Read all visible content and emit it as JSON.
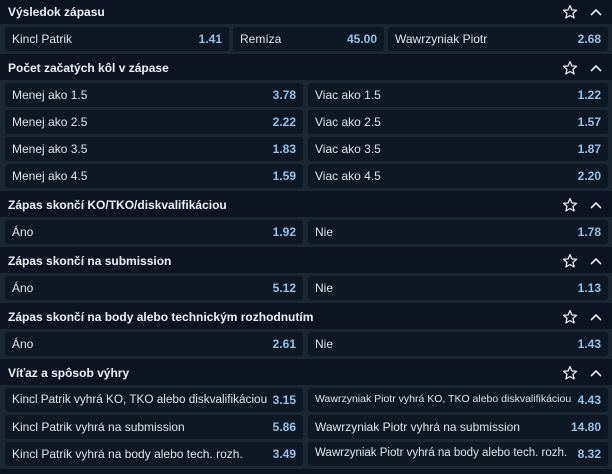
{
  "colors": {
    "background": "#0b1420",
    "panel": "#1b2633",
    "button": "#0e1823",
    "odd_value": "#8fc3ee",
    "text": "#dfe4ea"
  },
  "icons": {
    "favorite": "star-icon",
    "collapse": "chevron-up-icon"
  },
  "markets": [
    {
      "title": "Výsledok zápasu",
      "rows": [
        [
          {
            "label": "Kincl Patrik",
            "odd": "1.41"
          },
          {
            "label": "Remíza",
            "odd": "45.00"
          },
          {
            "label": "Wawrzyniak Piotr",
            "odd": "2.68"
          }
        ]
      ]
    },
    {
      "title": "Počet začatých kôl v zápase",
      "rows": [
        [
          {
            "label": "Menej ako 1.5",
            "odd": "3.78"
          },
          {
            "label": "Viac ako 1.5",
            "odd": "1.22"
          }
        ],
        [
          {
            "label": "Menej ako 2.5",
            "odd": "2.22"
          },
          {
            "label": "Viac ako 2.5",
            "odd": "1.57"
          }
        ],
        [
          {
            "label": "Menej ako 3.5",
            "odd": "1.83"
          },
          {
            "label": "Viac ako 3.5",
            "odd": "1.87"
          }
        ],
        [
          {
            "label": "Menej ako 4.5",
            "odd": "1.59"
          },
          {
            "label": "Viac ako 4.5",
            "odd": "2.20"
          }
        ]
      ]
    },
    {
      "title": "Zápas skončí KO/TKO/diskvalifikáciou",
      "rows": [
        [
          {
            "label": "Áno",
            "odd": "1.92"
          },
          {
            "label": "Nie",
            "odd": "1.78"
          }
        ]
      ]
    },
    {
      "title": "Zápas skončí na submission",
      "rows": [
        [
          {
            "label": "Áno",
            "odd": "5.12"
          },
          {
            "label": "Nie",
            "odd": "1.13"
          }
        ]
      ]
    },
    {
      "title": "Zápas skončí na body alebo technickým rozhodnutím",
      "rows": [
        [
          {
            "label": "Áno",
            "odd": "2.61"
          },
          {
            "label": "Nie",
            "odd": "1.43"
          }
        ]
      ]
    },
    {
      "title": "Víťaz a spôsob výhry",
      "rows": [
        [
          {
            "label": "Kincl Patrik vyhrá KO, TKO alebo diskvalifikáciou",
            "odd": "3.15"
          },
          {
            "label": "Wawrzyniak Piotr vyhrá KO, TKO alebo diskvalifikáciou",
            "odd": "4.43"
          }
        ],
        [
          {
            "label": "Kincl Patrik vyhrá na submission",
            "odd": "5.86"
          },
          {
            "label": "Wawrzyniak Piotr vyhrá na submission",
            "odd": "14.80"
          }
        ],
        [
          {
            "label": "Kincl Patrik vyhrá na body alebo tech. rozh.",
            "odd": "3.49"
          },
          {
            "label": "Wawrzyniak Piotr vyhrá na body alebo tech. rozh.",
            "odd": "8.32"
          }
        ]
      ]
    }
  ]
}
